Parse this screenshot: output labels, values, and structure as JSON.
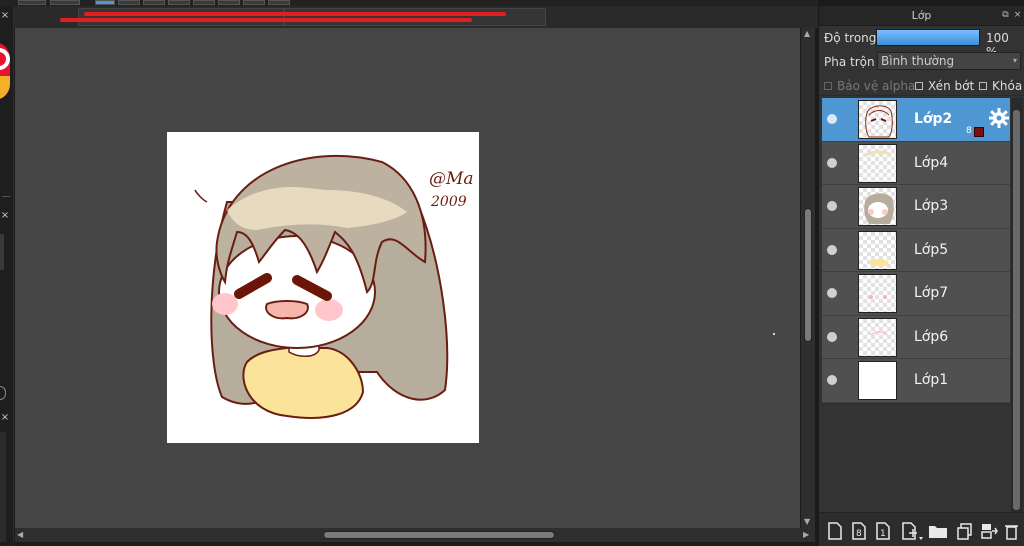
{
  "layer_panel": {
    "title": "Lớp",
    "opacity_label": "Độ trong",
    "opacity_value": "100 %",
    "opacity": 1.0,
    "blend_label": "Pha trộn",
    "blend_value": "Bình thường",
    "checkboxes": [
      {
        "label": "Bảo vệ alpha",
        "checked": false,
        "enabled": false
      },
      {
        "label": "Xén bớt",
        "checked": false,
        "enabled": true
      },
      {
        "label": "Khóa",
        "checked": false,
        "enabled": true
      }
    ],
    "layers": [
      {
        "name": "Lớp2",
        "selected": true,
        "visible": true,
        "sub_count": "8"
      },
      {
        "name": "Lớp4",
        "selected": false,
        "visible": true
      },
      {
        "name": "Lớp3",
        "selected": false,
        "visible": true
      },
      {
        "name": "Lớp5",
        "selected": false,
        "visible": true
      },
      {
        "name": "Lớp7",
        "selected": false,
        "visible": true
      },
      {
        "name": "Lớp6",
        "selected": false,
        "visible": true
      },
      {
        "name": "Lớp1",
        "selected": false,
        "visible": true
      }
    ]
  },
  "canvas": {
    "signature_lines": [
      "@Ma",
      "2009"
    ]
  },
  "icons": {
    "panel_close": "×",
    "panel_float": "⧉",
    "left_close": "×",
    "dropdown_caret": "▾"
  },
  "colors": {
    "accent": "#4e97d3",
    "canvas_bg": "#454545",
    "panel_bg": "#333333"
  }
}
